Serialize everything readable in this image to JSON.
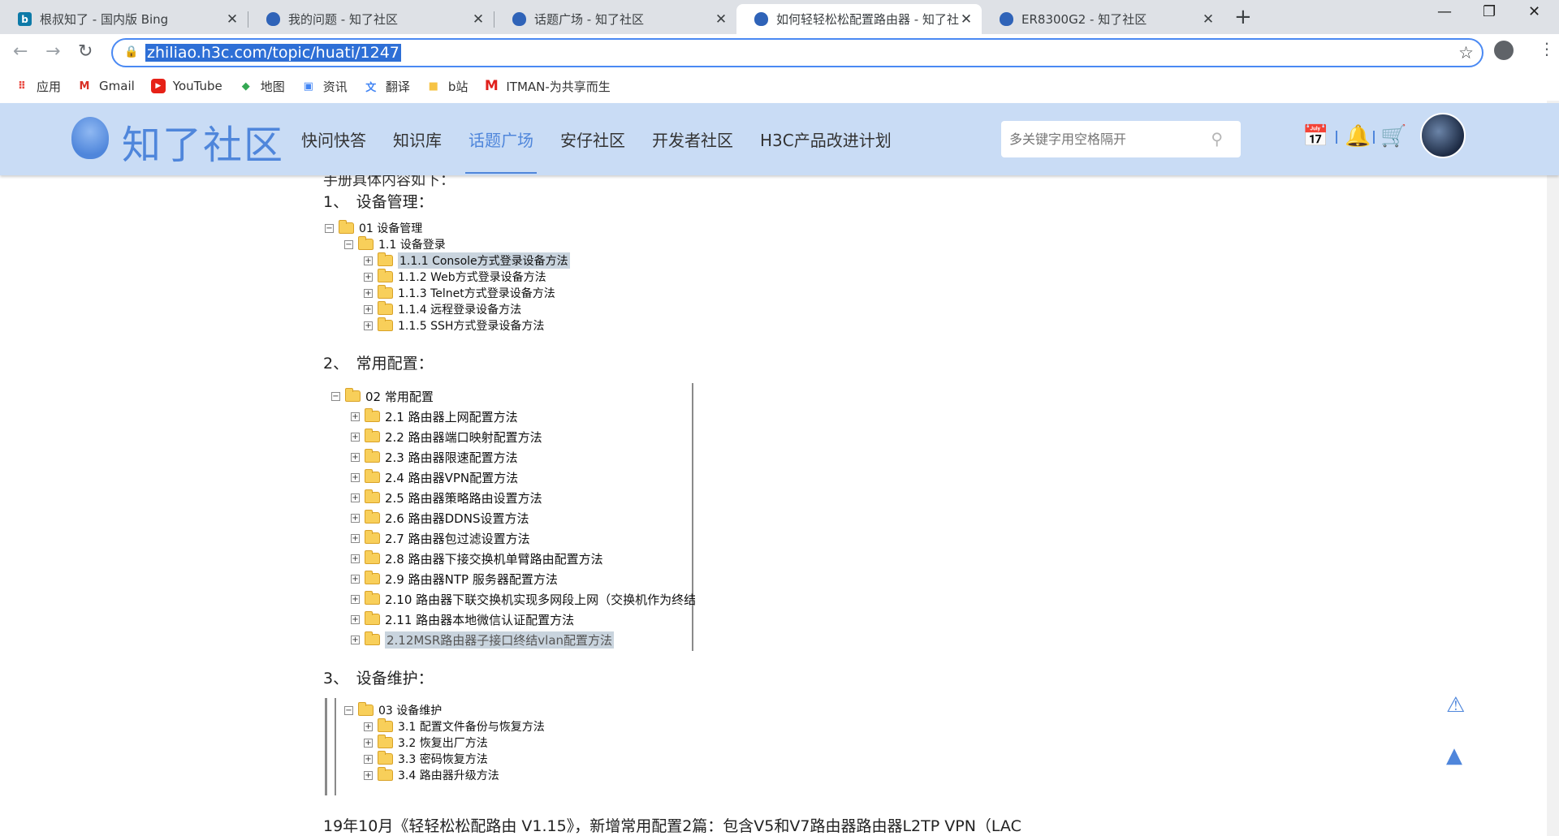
{
  "browser": {
    "tabs": [
      {
        "title": "根叔知了 - 国内版 Bing",
        "favicon": "bing-icon"
      },
      {
        "title": "我的问题 - 知了社区",
        "favicon": "h3c-icon"
      },
      {
        "title": "话题广场 - 知了社区",
        "favicon": "h3c-icon"
      },
      {
        "title": "如何轻轻松松配置路由器 - 知了社",
        "favicon": "h3c-icon"
      },
      {
        "title": "ER8300G2 - 知了社区",
        "favicon": "h3c-icon"
      }
    ],
    "url": "zhiliao.h3c.com/topic/huati/1247",
    "bookmarks": [
      {
        "label": "应用",
        "icon": "apps-grid-icon"
      },
      {
        "label": "Gmail",
        "icon": "gmail-icon"
      },
      {
        "label": "YouTube",
        "icon": "youtube-icon"
      },
      {
        "label": "地图",
        "icon": "maps-icon"
      },
      {
        "label": "资讯",
        "icon": "news-icon"
      },
      {
        "label": "翻译",
        "icon": "translate-icon"
      },
      {
        "label": "b站",
        "icon": "folder-icon"
      },
      {
        "label": "ITMAN-为共享而生",
        "icon": "itman-icon"
      }
    ]
  },
  "site": {
    "logo_text": "知了社区",
    "nav": [
      "快问快答",
      "知识库",
      "话题广场",
      "安仔社区",
      "开发者社区",
      "H3C产品改进计划"
    ],
    "active_nav": "话题广场",
    "search_placeholder": "多关键字用空格隔开"
  },
  "article": {
    "cut_line": "手册具体内容如下：",
    "sections": [
      {
        "head": "1、　设备管理：",
        "root": "01 设备管理",
        "sub": "1.1 设备登录",
        "items": [
          "1.1.1 Console方式登录设备方法",
          "1.1.2 Web方式登录设备方法",
          "1.1.3 Telnet方式登录设备方法",
          "1.1.4 远程登录设备方法",
          "1.1.5 SSH方式登录设备方法"
        ]
      },
      {
        "head": "2、　常用配置：",
        "root": "02 常用配置",
        "items": [
          "2.1 路由器上网配置方法",
          "2.2 路由器端口映射配置方法",
          "2.3 路由器限速配置方法",
          "2.4 路由器VPN配置方法",
          "2.5 路由器策略路由设置方法",
          "2.6 路由器DDNS设置方法",
          "2.7 路由器包过滤设置方法",
          "2.8 路由器下接交换机单臂路由配置方法",
          "2.9 路由器NTP 服务器配置方法",
          "2.10 路由器下联交换机实现多网段上网（交换机作为终结",
          "2.11 路由器本地微信认证配置方法",
          "2.12MSR路由器子接口终结vlan配置方法"
        ]
      },
      {
        "head": "3、　设备维护：",
        "root": "03 设备维护",
        "items": [
          "3.1 配置文件备份与恢复方法",
          "3.2 恢复出厂方法",
          "3.3 密码恢复方法",
          "3.4 路由器升级方法"
        ]
      }
    ],
    "footer_line": "19年10月《轻轻松松配路由 V1.15》，新增常用配置2篇：包含V5和V7路由器路由器L2TP VPN（LAC"
  }
}
